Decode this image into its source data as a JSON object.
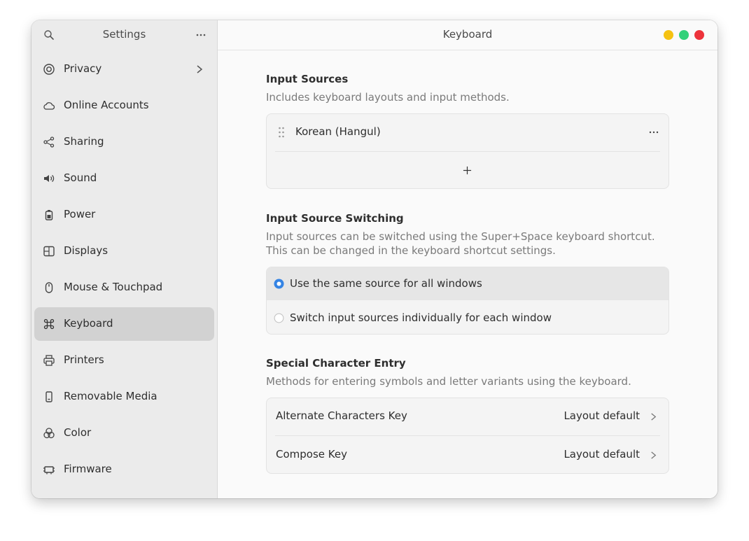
{
  "sidebar": {
    "title": "Settings",
    "items": [
      {
        "label": "Privacy",
        "icon": "privacy-icon"
      },
      {
        "label": "Online Accounts",
        "icon": "cloud-icon"
      },
      {
        "label": "Sharing",
        "icon": "share-icon"
      },
      {
        "label": "Sound",
        "icon": "speaker-icon"
      },
      {
        "label": "Power",
        "icon": "battery-icon"
      },
      {
        "label": "Displays",
        "icon": "display-icon"
      },
      {
        "label": "Mouse & Touchpad",
        "icon": "mouse-icon"
      },
      {
        "label": "Keyboard",
        "icon": "command-icon",
        "active": true
      },
      {
        "label": "Printers",
        "icon": "printer-icon"
      },
      {
        "label": "Removable Media",
        "icon": "usb-drive-icon"
      },
      {
        "label": "Color",
        "icon": "color-circles-icon"
      },
      {
        "label": "Firmware",
        "icon": "chip-icon"
      }
    ]
  },
  "header": {
    "title": "Keyboard"
  },
  "input_sources": {
    "title": "Input Sources",
    "description": "Includes keyboard layouts and input methods.",
    "sources": [
      {
        "label": "Korean (Hangul)"
      }
    ],
    "add_label": "+"
  },
  "switching": {
    "title": "Input Source Switching",
    "description_line1": "Input sources can be switched using the Super+Space keyboard shortcut.",
    "description_line2": "This can be changed in the keyboard shortcut settings.",
    "options": [
      {
        "label": "Use the same source for all windows",
        "selected": true
      },
      {
        "label": "Switch input sources individually for each window",
        "selected": false
      }
    ]
  },
  "special": {
    "title": "Special Character Entry",
    "description": "Methods for entering symbols and letter variants using the keyboard.",
    "rows": [
      {
        "label": "Alternate Characters Key",
        "value": "Layout default"
      },
      {
        "label": "Compose Key",
        "value": "Layout default"
      }
    ]
  },
  "colors": {
    "accent": "#3584e4",
    "minimize": "#f5c211",
    "maximize": "#33d17a",
    "close": "#ed333b"
  }
}
